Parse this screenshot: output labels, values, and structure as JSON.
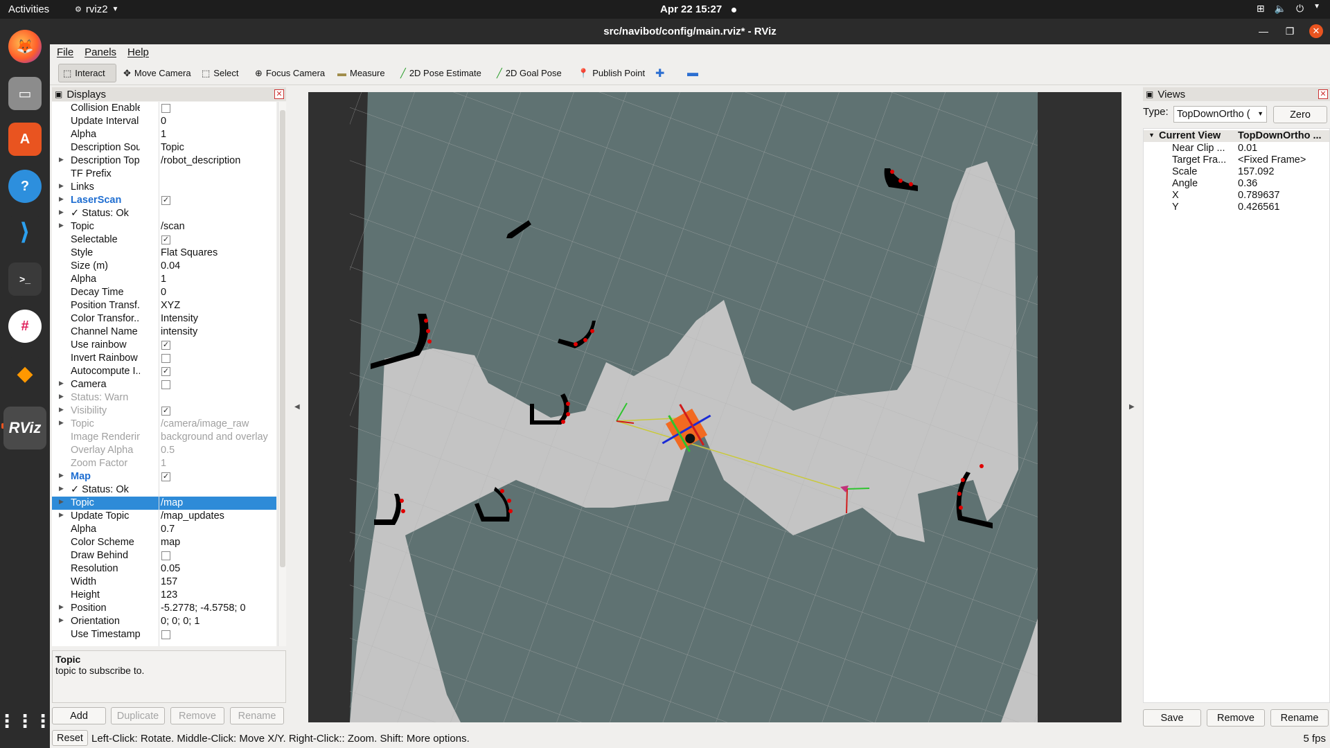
{
  "topbar": {
    "activities": "Activities",
    "app": "rviz2",
    "clock": "Apr 22  15:27"
  },
  "dock": {
    "icons": [
      "firefox-icon",
      "files-icon",
      "software-icon",
      "help-icon",
      "vscode-icon",
      "terminal-icon",
      "slack-icon",
      "sublime-icon",
      "rviz-icon"
    ],
    "rviz_label": "RViz"
  },
  "window": {
    "title": "src/navibot/config/main.rviz* - RViz"
  },
  "menu": {
    "file": "File",
    "panels": "Panels",
    "help": "Help"
  },
  "toolbar": {
    "interact": "Interact",
    "move_camera": "Move Camera",
    "select": "Select",
    "focus_camera": "Focus Camera",
    "measure": "Measure",
    "pose_estimate": "2D Pose Estimate",
    "goal_pose": "2D Goal Pose",
    "publish_point": "Publish Point"
  },
  "displays": {
    "title": "Displays",
    "rows": [
      {
        "key": "Collision Enabled",
        "check": false
      },
      {
        "key": "Update Interval",
        "value": "0"
      },
      {
        "key": "Alpha",
        "value": "1"
      },
      {
        "key": "Description Sou...",
        "value": "Topic"
      },
      {
        "key": "Description Topic",
        "value": "/robot_description",
        "arrow": true
      },
      {
        "key": "TF Prefix",
        "value": ""
      },
      {
        "key": "Links",
        "arrow": true
      },
      {
        "key": "LaserScan",
        "check": true,
        "group": true,
        "arrow": true
      },
      {
        "key": "✓ Status: Ok",
        "arrow": true
      },
      {
        "key": "Topic",
        "value": "/scan",
        "arrow": true
      },
      {
        "key": "Selectable",
        "check": true
      },
      {
        "key": "Style",
        "value": "Flat Squares"
      },
      {
        "key": "Size (m)",
        "value": "0.04"
      },
      {
        "key": "Alpha",
        "value": "1"
      },
      {
        "key": "Decay Time",
        "value": "0"
      },
      {
        "key": "Position Transf...",
        "value": "XYZ"
      },
      {
        "key": "Color Transfor...",
        "value": "Intensity"
      },
      {
        "key": "Channel Name",
        "value": "intensity"
      },
      {
        "key": "Use rainbow",
        "check": true
      },
      {
        "key": "Invert Rainbow",
        "check": false
      },
      {
        "key": "Autocompute I...",
        "check": true
      },
      {
        "key": "Camera",
        "check": false,
        "group": true,
        "arrow": true,
        "plain": true
      },
      {
        "key": "Status: Warn",
        "arrow": true,
        "disabled": true
      },
      {
        "key": "Visibility",
        "check": true,
        "arrow": true,
        "disabled": true
      },
      {
        "key": "Topic",
        "value": "/camera/image_raw",
        "arrow": true,
        "disabled": true
      },
      {
        "key": "Image Rendering",
        "value": "background and overlay",
        "disabled": true
      },
      {
        "key": "Overlay Alpha",
        "value": "0.5",
        "disabled": true
      },
      {
        "key": "Zoom Factor",
        "value": "1",
        "disabled": true
      },
      {
        "key": "Map",
        "check": true,
        "group": true,
        "arrow": true
      },
      {
        "key": "✓ Status: Ok",
        "arrow": true
      },
      {
        "key": "Topic",
        "value": "/map",
        "arrow": true,
        "selected": true
      },
      {
        "key": "Update Topic",
        "value": "/map_updates",
        "arrow": true
      },
      {
        "key": "Alpha",
        "value": "0.7"
      },
      {
        "key": "Color Scheme",
        "value": "map"
      },
      {
        "key": "Draw Behind",
        "check": false
      },
      {
        "key": "Resolution",
        "value": "0.05"
      },
      {
        "key": "Width",
        "value": "157"
      },
      {
        "key": "Height",
        "value": "123"
      },
      {
        "key": "Position",
        "value": "-5.2778; -4.5758; 0",
        "arrow": true
      },
      {
        "key": "Orientation",
        "value": "0; 0; 0; 1",
        "arrow": true
      },
      {
        "key": "Use Timestamp",
        "check": false
      }
    ]
  },
  "description": {
    "title": "Topic",
    "text": "topic to subscribe to."
  },
  "display_buttons": {
    "add": "Add",
    "duplicate": "Duplicate",
    "remove": "Remove",
    "rename": "Rename"
  },
  "statusbar": {
    "reset": "Reset",
    "help_text": "Left-Click: Rotate.  Middle-Click: Move X/Y.  Right-Click:: Zoom.  Shift: More options.",
    "fps": "5 fps"
  },
  "views": {
    "title": "Views",
    "type_label": "Type:",
    "type_value": "TopDownOrtho (",
    "zero": "Zero",
    "current_view_label": "Current View",
    "current_view_value": "TopDownOrtho ...",
    "props": [
      {
        "key": "Near Clip ...",
        "value": "0.01"
      },
      {
        "key": "Target Fra...",
        "value": "<Fixed Frame>"
      },
      {
        "key": "Scale",
        "value": "157.092"
      },
      {
        "key": "Angle",
        "value": "0.36"
      },
      {
        "key": "X",
        "value": "0.789637"
      },
      {
        "key": "Y",
        "value": "0.426561"
      }
    ],
    "save": "Save",
    "remove": "Remove",
    "rename": "Rename"
  },
  "colors": {
    "selection": "#2e8bd8",
    "map_free": "#c4c4c4",
    "map_unknown": "#5f7272",
    "laser": "#e00000",
    "robot": "#f26a21"
  }
}
